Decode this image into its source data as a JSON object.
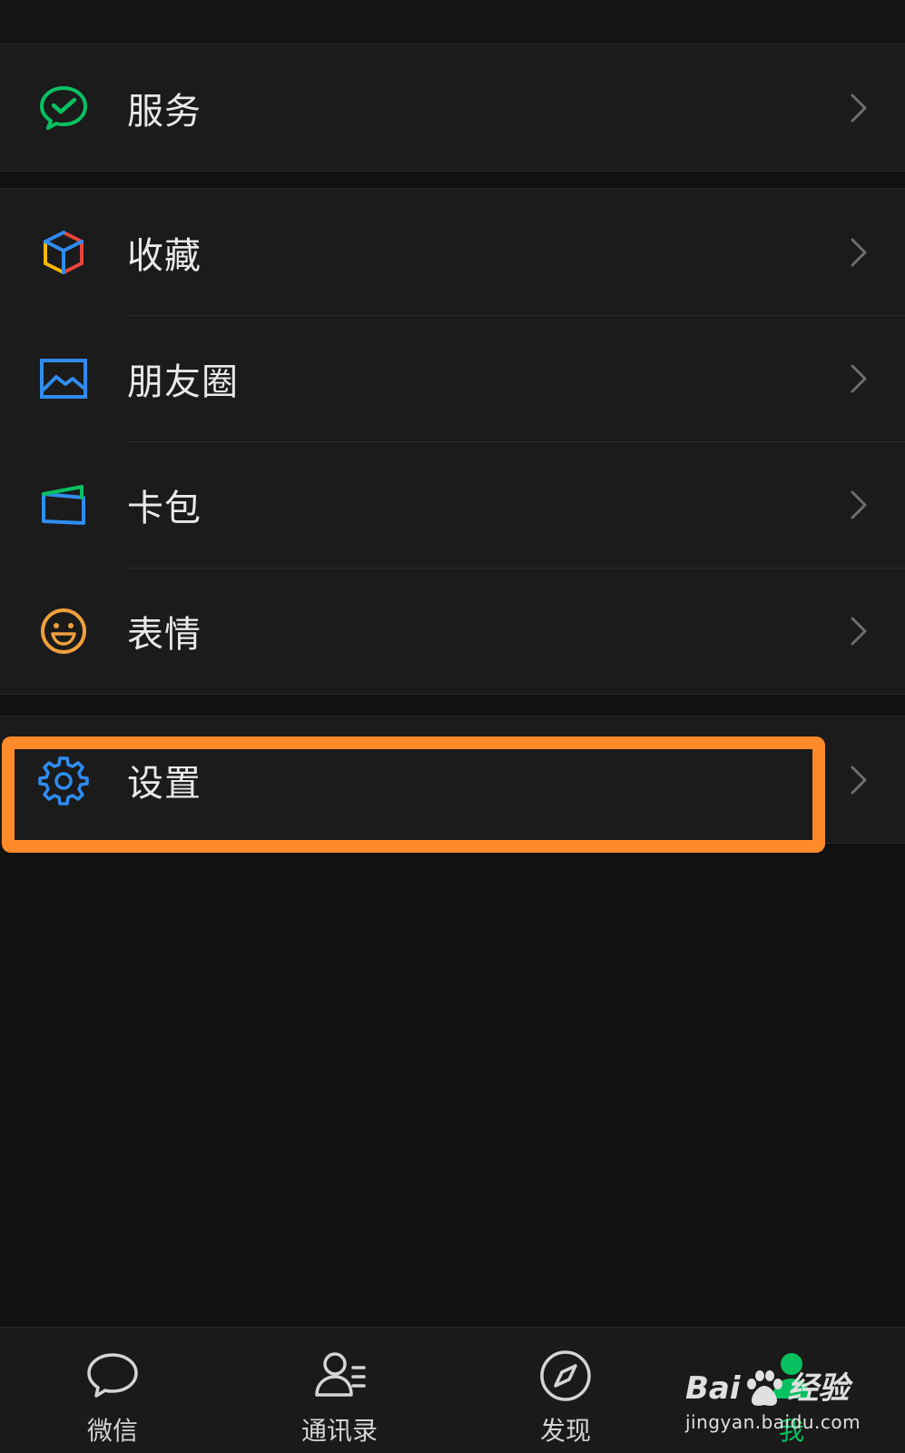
{
  "menu": {
    "services": {
      "label": "服务",
      "icon": "wechat-pay-icon",
      "color": "#07c160"
    },
    "favorites": {
      "label": "收藏",
      "icon": "favorites-cube-icon"
    },
    "moments": {
      "label": "朋友圈",
      "icon": "moments-photo-icon",
      "color": "#2f8cf0"
    },
    "cards": {
      "label": "卡包",
      "icon": "card-wallet-icon",
      "color": "#2f8cf0"
    },
    "stickers": {
      "label": "表情",
      "icon": "smiley-face-icon",
      "color": "#f0a03c"
    },
    "settings": {
      "label": "设置",
      "icon": "gear-icon",
      "color": "#2f8cf0",
      "highlighted": true
    }
  },
  "highlight_color": "#ff8a2a",
  "tabbar": {
    "tabs": [
      {
        "label": "微信",
        "icon": "chat-bubble-icon"
      },
      {
        "label": "通讯录",
        "icon": "contacts-icon"
      },
      {
        "label": "发现",
        "icon": "compass-icon"
      },
      {
        "label": "我",
        "icon": "me-person-icon",
        "active": true
      }
    ],
    "active_color": "#07c160"
  },
  "watermark": {
    "brand_left": "Bai",
    "brand_right": "经验",
    "url": "jingyan.baidu.com"
  }
}
